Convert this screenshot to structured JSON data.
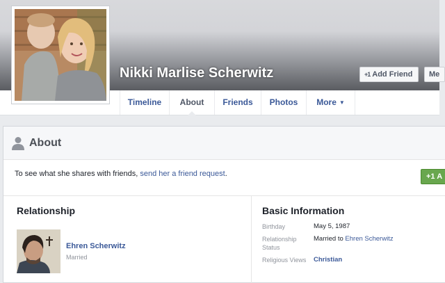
{
  "profile": {
    "name": "Nikki Marlise Scherwitz"
  },
  "header_buttons": {
    "add_friend": "Add Friend",
    "message": "Me",
    "plus_glyph": "+1"
  },
  "tabs": [
    {
      "label": "Timeline",
      "active": false
    },
    {
      "label": "About",
      "active": true
    },
    {
      "label": "Friends",
      "active": false
    },
    {
      "label": "Photos",
      "active": false
    },
    {
      "label": "More",
      "active": false
    }
  ],
  "about": {
    "title": "About",
    "notice_prefix": "To see what she shares with friends, ",
    "notice_link": "send her a friend request",
    "notice_suffix": ".",
    "green_button": "+1 A"
  },
  "relationship": {
    "title": "Relationship",
    "partner_name": "Ehren Scherwitz",
    "status": "Married"
  },
  "basic_info": {
    "title": "Basic Information",
    "birthday_label": "Birthday",
    "birthday_value": "May 5, 1987",
    "relationship_label_line1": "Relationship",
    "relationship_label_line2": "Status",
    "relationship_value_prefix": "Married to ",
    "relationship_value_link": "Ehren Scherwitz",
    "religion_label": "Religious Views",
    "religion_value": "Christian"
  },
  "colors": {
    "link_blue": "#3b5998",
    "green": "#69a74e",
    "page_bg": "#e9ebee"
  }
}
